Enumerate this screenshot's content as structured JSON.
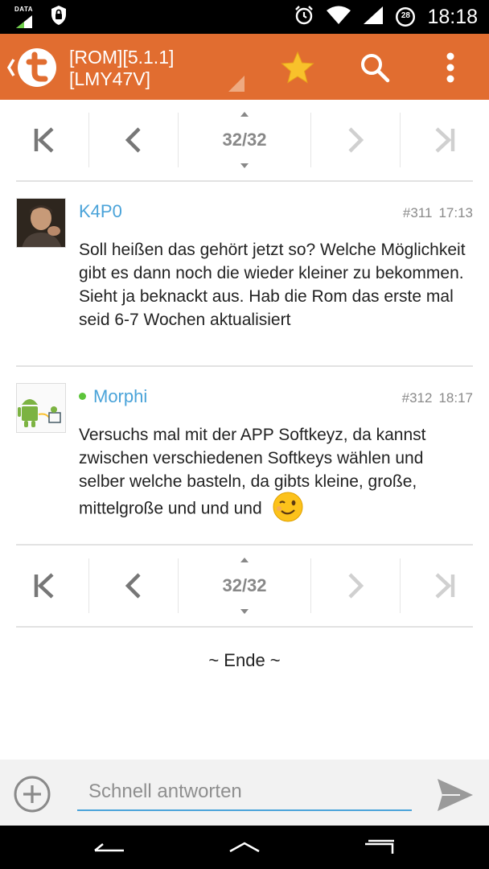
{
  "status_bar": {
    "time": "18:18",
    "data_label": "DATA",
    "battery_level": "28",
    "icons": [
      "data-signal-icon",
      "shield-icon",
      "alarm-icon",
      "wifi-icon",
      "cell-signal-icon",
      "battery-icon"
    ]
  },
  "app_bar": {
    "title_line1": "[ROM][5.1.1]",
    "title_line2": "[LMY47V]",
    "background": "#e16d30",
    "icons": [
      "back-icon",
      "tapatalk-logo-icon",
      "star-icon",
      "search-icon",
      "more-vert-icon"
    ]
  },
  "pager": {
    "top_page": "32/32",
    "bottom_page": "32/32",
    "icons": [
      "first-page-icon",
      "prev-page-icon",
      "next-page-icon",
      "last-page-icon"
    ]
  },
  "posts": [
    {
      "author": "K4P0",
      "number": "#311",
      "time": "17:13",
      "online": false,
      "body": "Soll heißen das gehört jetzt so? Welche Möglichkeit gibt es dann noch die wieder kleiner zu bekommen. Sieht ja beknackt aus. Hab die Rom das erste mal seid 6-7 Wochen aktualisiert"
    },
    {
      "author": "Morphi",
      "number": "#312",
      "time": "18:17",
      "online": true,
      "body": "Versuchs mal mit der APP Softkeyz, da kannst zwischen verschiedenen Softkeys wählen und selber welche basteln, da gibts kleine, große, mittelgroße und und und",
      "emoji": "wink-emoji-icon"
    }
  ],
  "end_label": "~ Ende ~",
  "reply": {
    "placeholder": "Schnell antworten",
    "value": "",
    "accent": "#4aa3d9"
  },
  "nav_bar": {
    "icons": [
      "nav-back-icon",
      "nav-home-icon",
      "nav-recents-icon"
    ]
  }
}
